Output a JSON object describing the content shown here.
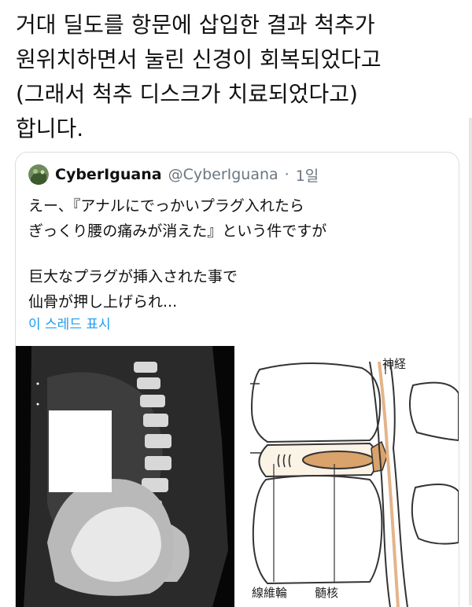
{
  "tweet": {
    "lines": [
      "거대 딜도를 항문에 삽입한 결과 척추가",
      "원위치하면서 눌린 신경이 회복되었다고",
      "(그래서 척추 디스크가 치료되었다고)",
      "합니다."
    ]
  },
  "quote": {
    "author_name": "CyberIguana",
    "author_handle": "@CyberIguana",
    "separator": "·",
    "time": "1일",
    "body_lines_1": [
      "えー、『アナルにでっかいプラグ入れたら",
      "ぎっくり腰の痛みが消えた』という件ですが"
    ],
    "body_lines_2": [
      "巨大なプラグが挿入された事で",
      "仙骨が押し上げられ..."
    ],
    "show_thread": "이 스레드 표시"
  },
  "diagram": {
    "label_nerve": "神経",
    "label_annulus": "線維輪",
    "label_nucleus": "髄核"
  },
  "colors": {
    "link": "#1d9bf0",
    "muted": "#6b7680",
    "nucleus": "#d9a36b"
  }
}
